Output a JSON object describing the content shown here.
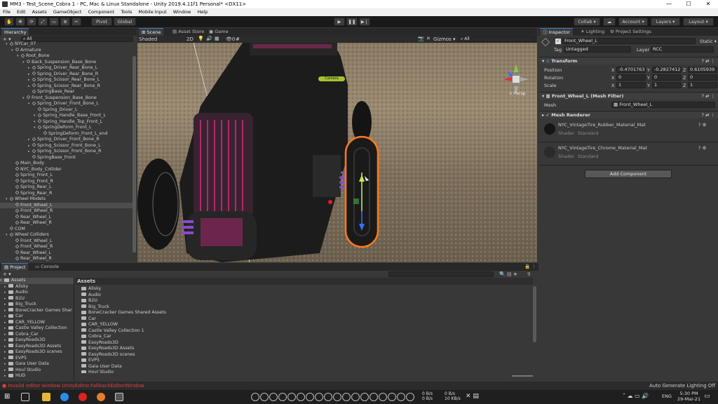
{
  "window": {
    "title": "MM3 - Test_Scene_Cobra 1 - PC, Mac & Linux Standalone - Unity 2019.4.11f1 Personal* <DX11>",
    "min": "—",
    "max": "☐",
    "close": "✕"
  },
  "menu": [
    "File",
    "Edit",
    "Assets",
    "GameObject",
    "Component",
    "Tools",
    "Mobile Input",
    "Window",
    "Help"
  ],
  "toolbar": {
    "pivot": "Pivot",
    "global": "Global",
    "collab": "Collab ▾",
    "account": "Account ▾",
    "layers": "Layers ▾",
    "layout": "Layout ▾"
  },
  "hierarchy": {
    "tab": "Hierarchy",
    "plus": "+ ▾",
    "search": "All",
    "rows": [
      {
        "d": 3,
        "t": "NYCar_07",
        "f": "▾"
      },
      {
        "d": 4,
        "t": "Armature",
        "f": "▾"
      },
      {
        "d": 5,
        "t": "Root_Bone",
        "f": "▾"
      },
      {
        "d": 6,
        "t": "Back_Suspension_Base_Bone",
        "f": "▾"
      },
      {
        "d": 7,
        "t": "Spring_Driver_Rear_Bone_L",
        "f": "▸"
      },
      {
        "d": 7,
        "t": "Spring_Driver_Rear_Bone_R",
        "f": "▸"
      },
      {
        "d": 7,
        "t": "Spring_Scissor_Rear_Bone_L",
        "f": "▸"
      },
      {
        "d": 7,
        "t": "Spring_Scissor_Rear_Bone_R",
        "f": "▸"
      },
      {
        "d": 7,
        "t": "SpringBase_Rear",
        "f": ""
      },
      {
        "d": 6,
        "t": "Front_Suspension_Base_Bone",
        "f": "▾"
      },
      {
        "d": 7,
        "t": "Spring_Driver_Front_Bone_L",
        "f": "▾"
      },
      {
        "d": 8,
        "t": "Spring_Driver_L",
        "f": ""
      },
      {
        "d": 8,
        "t": "Spring_Handle_Base_Front_L",
        "f": "▾"
      },
      {
        "d": 8,
        "t": "Spring_Handle_Top_Front_L",
        "f": "▾"
      },
      {
        "d": 8,
        "t": "SpringDeform_Front_L",
        "f": "▾"
      },
      {
        "d": 9,
        "t": "SpringDeform_Front_L_end",
        "f": ""
      },
      {
        "d": 7,
        "t": "Spring_Driver_Front_Bone_R",
        "f": "▸"
      },
      {
        "d": 7,
        "t": "Spring_Scissor_Front_Bone_L",
        "f": "▸"
      },
      {
        "d": 7,
        "t": "Spring_Scissor_Front_Bone_R",
        "f": "▸"
      },
      {
        "d": 7,
        "t": "SpringBase_Front",
        "f": ""
      },
      {
        "d": 4,
        "t": "Main_Body",
        "f": ""
      },
      {
        "d": 4,
        "t": "NYC_Body_Collider",
        "f": ""
      },
      {
        "d": 4,
        "t": "Spring_Front_L",
        "f": ""
      },
      {
        "d": 4,
        "t": "Spring_Front_R",
        "f": ""
      },
      {
        "d": 4,
        "t": "Spring_Rear_L",
        "f": ""
      },
      {
        "d": 4,
        "t": "Spring_Rear_R",
        "f": ""
      },
      {
        "d": 3,
        "t": "Wheel Models",
        "f": "▾"
      },
      {
        "d": 4,
        "t": "Front_Wheel_L",
        "f": "",
        "sel": true
      },
      {
        "d": 4,
        "t": "Front_Wheel_R",
        "f": ""
      },
      {
        "d": 4,
        "t": "Rear_Wheel_L",
        "f": ""
      },
      {
        "d": 4,
        "t": "Rear_Wheel_R",
        "f": ""
      },
      {
        "d": 3,
        "t": "COM",
        "f": ""
      },
      {
        "d": 3,
        "t": "Wheel Colliders",
        "f": "▾"
      },
      {
        "d": 4,
        "t": "Front_Wheel_L",
        "f": ""
      },
      {
        "d": 4,
        "t": "Front_Wheel_R",
        "f": ""
      },
      {
        "d": 4,
        "t": "Rear_Wheel_L",
        "f": ""
      },
      {
        "d": 4,
        "t": "Rear_Wheel_R",
        "f": ""
      }
    ]
  },
  "scene": {
    "tabs": [
      "Scene",
      "Asset Store",
      "Game"
    ],
    "shading": "Shaded",
    "mode2d": "2D",
    "gizmos": "Gizmos ▾",
    "search": "All",
    "persp": "< Persp",
    "camera_label": "Camera",
    "counter": "0"
  },
  "inspector": {
    "tabs": [
      "Inspector",
      "Lighting",
      "Project Settings"
    ],
    "name": "Front_Wheel_L",
    "static": "Static ▾",
    "tag_label": "Tag",
    "tag": "Untagged",
    "layer_label": "Layer",
    "layer": "RCC",
    "transform": {
      "title": "Transform",
      "position": "Position",
      "rotation": "Rotation",
      "scale": "Scale",
      "pos": [
        "-0.4701763",
        "-0.2827412",
        "0.6105939"
      ],
      "rot": [
        "0",
        "0",
        "0"
      ],
      "scl": [
        "1",
        "1",
        "1"
      ]
    },
    "meshfilter": {
      "title": "Front_Wheel_L (Mesh Filter)",
      "label": "Mesh",
      "value": "Front_Wheel_L"
    },
    "renderer": {
      "title": "Mesh Renderer"
    },
    "materials": [
      {
        "name": "NYC_VintageTire_Rubber_Material_Mat",
        "shader": "Standard"
      },
      {
        "name": "NYC_VintageTire_Chrome_Material_Mat",
        "shader": "Standard"
      }
    ],
    "shader_label": "Shader",
    "add_component": "Add Component"
  },
  "project": {
    "tabs": [
      "Project",
      "Console"
    ],
    "plus": "+ ▾",
    "badge": "9",
    "tree_root": "Assets",
    "grid_header": "Assets",
    "tree": [
      "Allsky",
      "Audio",
      "B2U",
      "Big_Truck",
      "BoneCracker Games Shar",
      "Car",
      "CAR_YELLOW",
      "Castle Valley Collection",
      "Cobra_Car",
      "EasyRoads3D",
      "EasyRoads3D Assets",
      "EasyRoads3D scenes",
      "EVP5",
      "Gaia User Data",
      "Hovl Studio",
      "HUD"
    ],
    "grid": [
      "Allsky",
      "Audio",
      "B2U",
      "Big_Truck",
      "BoneCracker Games Shared Assets",
      "Car",
      "CAR_YELLOW",
      "Castle Valley Collection 1",
      "Cobra_Car",
      "EasyRoads3D",
      "EasyRoads3D Assets",
      "EasyRoads3D scenes",
      "EVP5",
      "Gaia User Data",
      "Hovl Studio"
    ]
  },
  "status": {
    "error": "Invalid editor window UnityEditor.FallbackEditorWindow",
    "lighting": "Auto Generate Lighting Off"
  },
  "taskbar": {
    "net1": "0 B/s",
    "net1b": "0 B/s",
    "net2": "0 B/s",
    "net2b": "10 KB/s",
    "lang": "ENG",
    "time": "5:30 PM",
    "date": "29-Mar-21"
  }
}
